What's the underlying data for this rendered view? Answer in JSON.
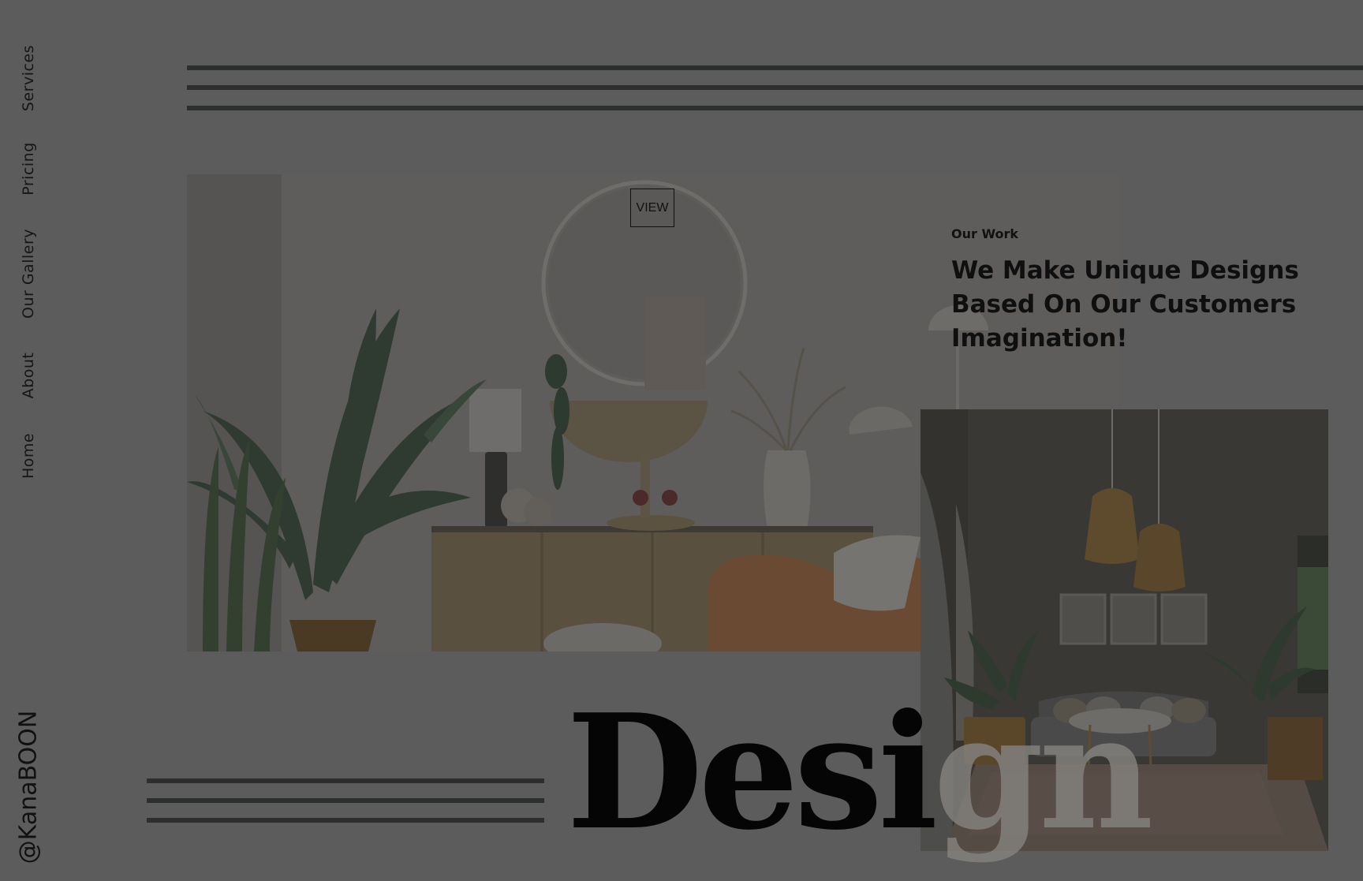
{
  "side_nav": {
    "items": [
      {
        "label": "Services"
      },
      {
        "label": "Pricing"
      },
      {
        "label": "Our Gallery"
      },
      {
        "label": "About"
      },
      {
        "label": "Home"
      }
    ]
  },
  "social": {
    "handle": "@KanaBOON"
  },
  "hero": {
    "view_label": "VIEW",
    "section_label": "Our Work",
    "tagline": "We Make Unique Designs Based On Our Customers Imagination!"
  },
  "headline": {
    "dark_part": "Desi",
    "light_part": "gn"
  },
  "colors": {
    "background": "#5c5c5c",
    "stripe": "#2c2f2e",
    "text": "#111111"
  }
}
